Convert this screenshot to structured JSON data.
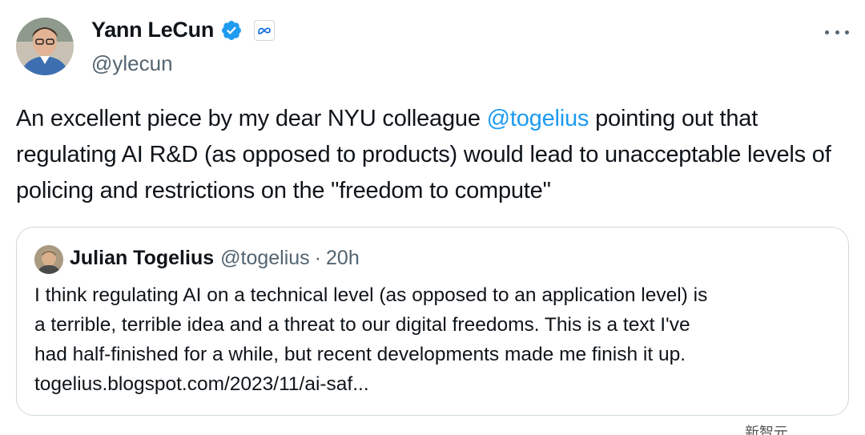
{
  "author": {
    "name": "Yann LeCun",
    "handle": "@ylecun",
    "avatar_icon": "person-avatar",
    "verified_icon": "verified-badge-icon",
    "affiliation_icon": "meta-logo-icon"
  },
  "more_icon": "more-horizontal-icon",
  "tweet": {
    "text_before": "An excellent piece by my dear NYU colleague ",
    "mention": "@togelius",
    "text_after": " pointing out that regulating AI R&D (as opposed to products) would lead to unacceptable levels of policing and restrictions on the \"freedom to compute\""
  },
  "quote": {
    "name": "Julian Togelius",
    "handle": "@togelius",
    "separator": "·",
    "time": "20h",
    "lines": [
      "I think regulating AI on a technical level (as opposed to an application level) is",
      "a terrible, terrible idea and a threat to our digital freedoms. This is a text I've",
      "had half-finished for a while, but recent developments made me finish it up.",
      "togelius.blogspot.com/2023/11/ai-saf..."
    ]
  },
  "watermark": {
    "text": "新智元"
  },
  "colors": {
    "link": "#1d9bf0",
    "text": "#0f1419",
    "secondary": "#536471",
    "border": "#cfd9de"
  }
}
